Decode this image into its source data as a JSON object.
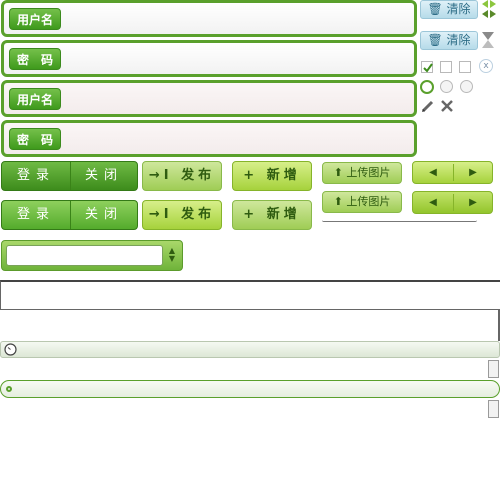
{
  "login": {
    "username_label": "用户名",
    "password_label": "密　码"
  },
  "clear": {
    "label": "清除",
    "icon": "trash-icon"
  },
  "buttons": {
    "login": "登录",
    "close": "关闭",
    "publish": "发布",
    "add": "新增",
    "upload": "上传图片",
    "prev": "◀",
    "next": "▶"
  },
  "controls": {
    "close_x": "x"
  },
  "select": {
    "value": ""
  },
  "colors": {
    "accent": "#5aa02c",
    "dark_green": "#3d8c1c",
    "lime": "#a6d23c",
    "clear_blue": "#b6dbe9"
  }
}
